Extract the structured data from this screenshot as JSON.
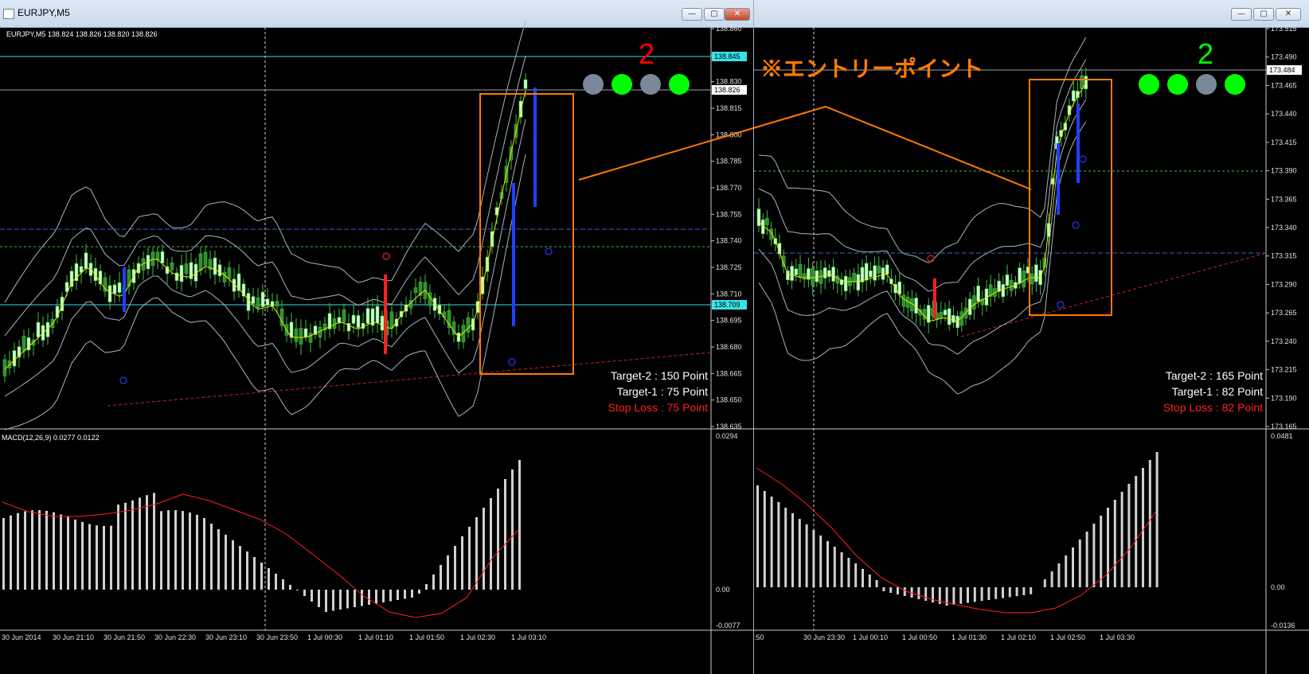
{
  "windows": [
    {
      "id": "left",
      "title": "EURJPY,M5",
      "symbol_info": "EURJPY,M5  138.824 138.826 138.820 138.826",
      "signal_number": "2",
      "signal_color": "#ff0000",
      "signal_dots": [
        "#7a8899",
        "#00ff00",
        "#7a8899",
        "#00ff00"
      ],
      "price_axis": [
        "138.860",
        "138.845",
        "138.830",
        "138.815",
        "138.800",
        "138.785",
        "138.770",
        "138.755",
        "138.740",
        "138.725",
        "138.710",
        "138.695",
        "138.680",
        "138.665",
        "138.650",
        "138.635"
      ],
      "price_flags": [
        {
          "text": "138.845",
          "style": "cyan"
        },
        {
          "text": "138.826",
          "style": "white"
        },
        {
          "text": "138.709",
          "style": "cyan"
        }
      ],
      "targets": {
        "target2": "Target-2 : 150 Point",
        "target1": "Target-1 : 75 Point",
        "stoploss": "Stop Loss : 75 Point"
      },
      "indicator_label": "MACD(12,26,9) 0.0277 0.0122",
      "macd_axis": [
        "0.0294",
        "0.00",
        "-0.0077"
      ],
      "time_axis": [
        "30 Jun 2014",
        "30 Jun 21:10",
        "30 Jun 21:50",
        "30 Jun 22:30",
        "30 Jun 23:10",
        "30 Jun 23:50",
        "1 Jul 00:30",
        "1 Jul 01:10",
        "1 Jul 01:50",
        "1 Jul 02:30",
        "1 Jul 03:10"
      ]
    },
    {
      "id": "right",
      "title": "",
      "symbol_info": "",
      "signal_number": "2",
      "signal_color": "#00ff00",
      "signal_dots": [
        "#00ff00",
        "#00ff00",
        "#7a8899",
        "#00ff00"
      ],
      "price_axis": [
        "173.515",
        "173.490",
        "173.465",
        "173.440",
        "173.415",
        "173.390",
        "173.365",
        "173.340",
        "173.315",
        "173.290",
        "173.265",
        "173.240",
        "173.215",
        "173.190",
        "173.165"
      ],
      "price_flags": [
        {
          "text": "173.484",
          "style": "white"
        }
      ],
      "targets": {
        "target2": "Target-2 : 165 Point",
        "target1": "Target-1 : 82 Point",
        "stoploss": "Stop Loss : 82 Point"
      },
      "indicator_label": "",
      "macd_axis": [
        "0.0481",
        "0.00",
        "-0.0136"
      ],
      "time_axis": [
        ":50",
        "30 Jun 23:30",
        "1 Jul 00:10",
        "1 Jul 00:50",
        "1 Jul 01:30",
        "1 Jul 02:10",
        "1 Jul 02:50",
        "1 Jul 03:30"
      ]
    }
  ],
  "annotation": {
    "text": "※エントリーポイント",
    "color": "#ff7a00"
  },
  "colors": {
    "bg": "#000000",
    "bull": "#ccffcc",
    "bear": "#2f8f2f",
    "band": "#aab4c0",
    "cyan": "#39e0e8",
    "box": "#ff7a00",
    "macd_bar": "#d0d0d0",
    "signal_line": "#ff2020"
  }
}
